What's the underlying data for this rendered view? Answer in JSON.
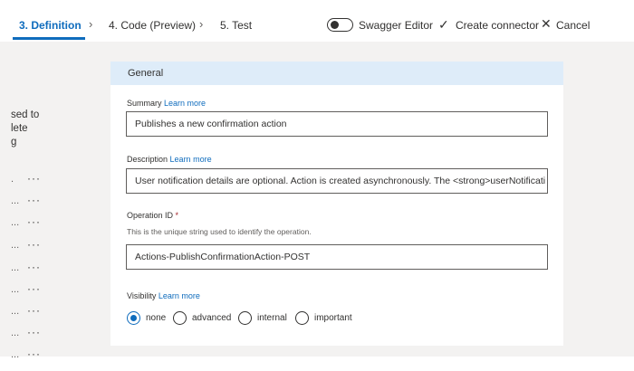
{
  "tabs": [
    {
      "label": "3. Definition",
      "active": true
    },
    {
      "label": "4. Code (Preview)",
      "active": false
    },
    {
      "label": "5. Test",
      "active": false
    }
  ],
  "toolbar": {
    "swagger_label": "Swagger Editor",
    "swagger_enabled": false,
    "create_label": "Create connector",
    "cancel_label": "Cancel"
  },
  "left_pane": {
    "text_lines": [
      "sed to",
      "lete",
      "g"
    ],
    "row_markers": [
      ".",
      "...",
      "...",
      "...",
      "...",
      "...",
      "...",
      "...",
      "...",
      "..."
    ]
  },
  "card": {
    "title": "General",
    "summary": {
      "label": "Summary",
      "learn_more": "Learn more",
      "value": "Publishes a new confirmation action"
    },
    "description": {
      "label": "Description",
      "learn_more": "Learn more",
      "value": "User notification details are optional. Action is created asynchronously. The <strong>userNotificati"
    },
    "operation_id": {
      "label": "Operation ID",
      "required_mark": "*",
      "hint": "This is the unique string used to identify the operation.",
      "value": "Actions-PublishConfirmationAction-POST"
    },
    "visibility": {
      "label": "Visibility",
      "learn_more": "Learn more",
      "options": [
        "none",
        "advanced",
        "internal",
        "important"
      ],
      "selected": "none"
    }
  },
  "colors": {
    "accent": "#0f6cbd",
    "header_bg": "#deecf9",
    "content_bg": "#f3f2f1"
  }
}
